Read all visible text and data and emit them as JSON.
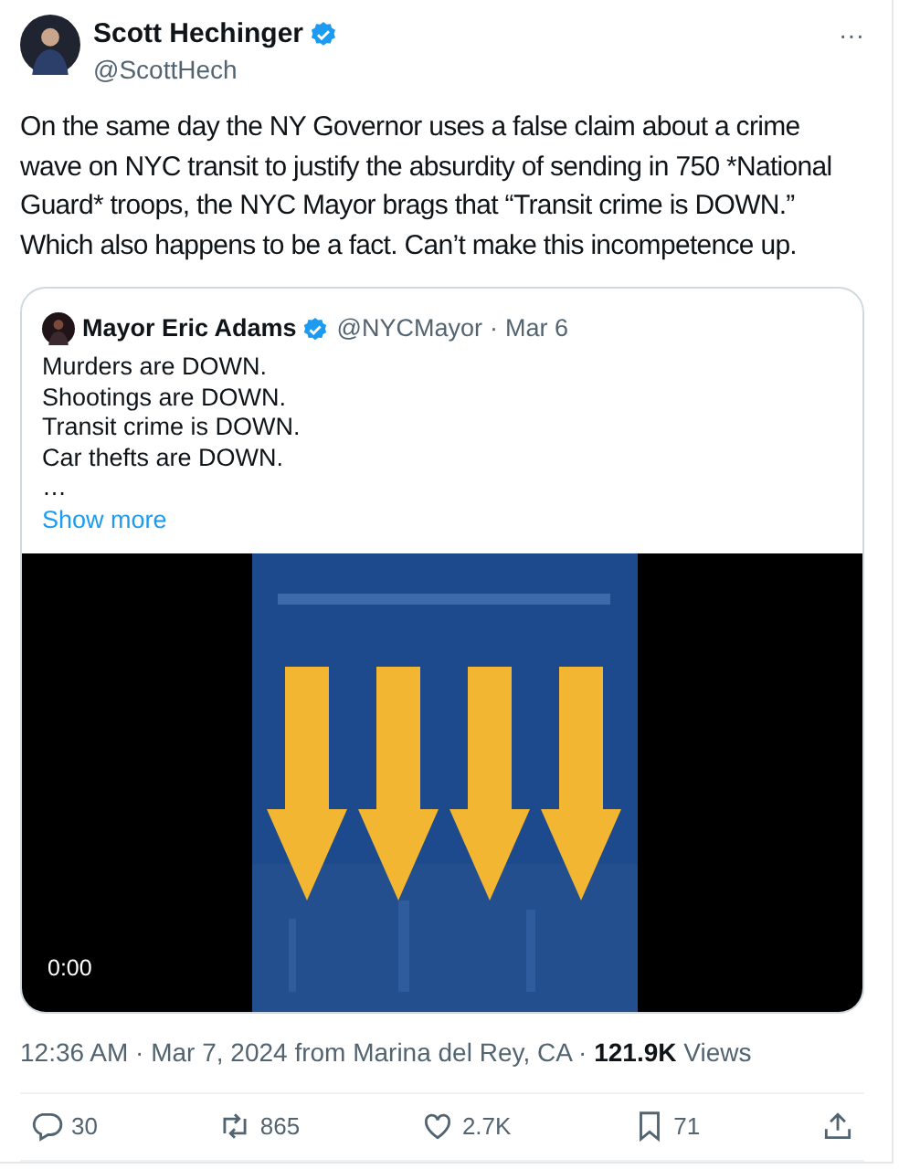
{
  "author": {
    "name": "Scott Hechinger",
    "handle": "@ScottHech",
    "verified": true
  },
  "more_button": "···",
  "text": "On the same day the NY Governor uses a false claim about a crime wave on NYC transit to justify the absurdity of sending in 750 *National Guard* troops, the NYC Mayor brags that “Transit crime is DOWN.” Which also happens to be a fact. Can’t make this incompetence up.",
  "quote": {
    "name": "Mayor Eric Adams",
    "verified": true,
    "handle": "@NYCMayor",
    "separator": "·",
    "date": "Mar 6",
    "lines": [
      "Murders are DOWN.",
      "Shootings are DOWN.",
      "Transit crime is DOWN.",
      "Car thefts are DOWN.",
      "…"
    ],
    "show_more": "Show more",
    "video": {
      "kind": "picture",
      "time": "0:00"
    }
  },
  "meta": {
    "time": "12:36 AM · Mar 7, 2024 from Marina del Rey, CA · ",
    "views_count": "121.9K",
    "views_label": " Views"
  },
  "actions": [
    {
      "kind": "reply",
      "count": "30"
    },
    {
      "kind": "repost",
      "count": "865"
    },
    {
      "kind": "like",
      "count": "2.7K"
    },
    {
      "kind": "bookmark",
      "count": "71"
    },
    {
      "kind": "share"
    }
  ]
}
